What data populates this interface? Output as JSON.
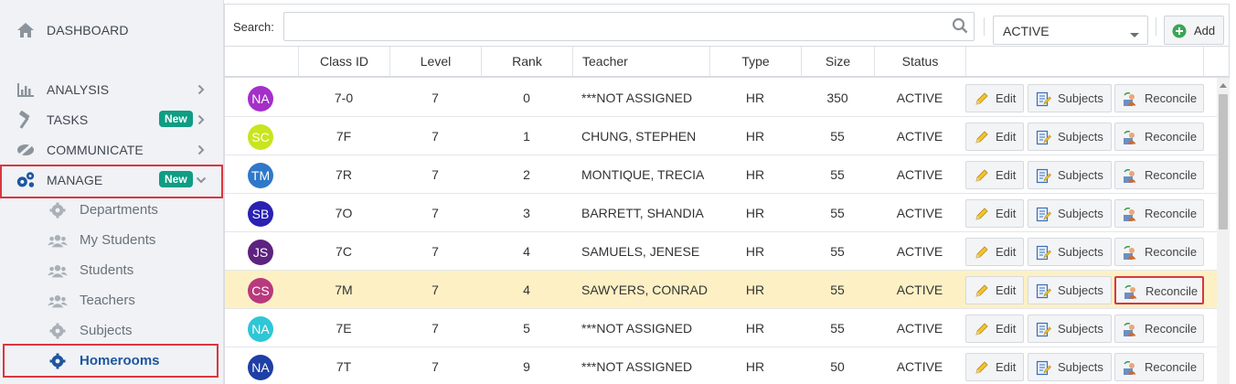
{
  "sidebar": {
    "nav": [
      {
        "label": "DASHBOARD",
        "icon": "home-icon"
      },
      {
        "label": "ANALYSIS",
        "icon": "bar-chart-icon"
      },
      {
        "label": "TASKS",
        "icon": "hammer-icon",
        "badge": "New"
      },
      {
        "label": "COMMUNICATE",
        "icon": "megaphone-icon"
      },
      {
        "label": "MANAGE",
        "icon": "gears-icon",
        "badge": "New"
      }
    ],
    "manage_items": [
      {
        "label": "Departments",
        "icon": "gear-icon"
      },
      {
        "label": "My Students",
        "icon": "users-icon"
      },
      {
        "label": "Students",
        "icon": "users-icon"
      },
      {
        "label": "Teachers",
        "icon": "users-icon"
      },
      {
        "label": "Subjects",
        "icon": "gear-icon"
      },
      {
        "label": "Homerooms",
        "icon": "gear-icon",
        "active": true
      }
    ]
  },
  "toolbar": {
    "search_label": "Search:",
    "search_value": "",
    "status_value": "ACTIVE",
    "add_label": "Add"
  },
  "table": {
    "columns": [
      "Class ID",
      "Level",
      "Rank",
      "Teacher",
      "Type",
      "Size",
      "Status"
    ],
    "actions": {
      "edit": "Edit",
      "subjects": "Subjects",
      "reconcile": "Reconcile"
    },
    "rows": [
      {
        "initials": "NA",
        "color": "#a52fc9",
        "class_id": "7-0",
        "level": "7",
        "rank": "0",
        "teacher": "***NOT ASSIGNED",
        "type": "HR",
        "size": "350",
        "status": "ACTIVE"
      },
      {
        "initials": "SC",
        "color": "#c8e51f",
        "class_id": "7F",
        "level": "7",
        "rank": "1",
        "teacher": "CHUNG, STEPHEN",
        "type": "HR",
        "size": "55",
        "status": "ACTIVE"
      },
      {
        "initials": "TM",
        "color": "#2f78c9",
        "class_id": "7R",
        "level": "7",
        "rank": "2",
        "teacher": "MONTIQUE, TRECIA",
        "type": "HR",
        "size": "55",
        "status": "ACTIVE"
      },
      {
        "initials": "SB",
        "color": "#2a21b3",
        "class_id": "7O",
        "level": "7",
        "rank": "3",
        "teacher": "BARRETT, SHANDIA",
        "type": "HR",
        "size": "55",
        "status": "ACTIVE"
      },
      {
        "initials": "JS",
        "color": "#5e2280",
        "class_id": "7C",
        "level": "7",
        "rank": "4",
        "teacher": "SAMUELS, JENESE",
        "type": "HR",
        "size": "55",
        "status": "ACTIVE"
      },
      {
        "initials": "CS",
        "color": "#b8397d",
        "class_id": "7M",
        "level": "7",
        "rank": "4",
        "teacher": "SAWYERS, CONRAD",
        "type": "HR",
        "size": "55",
        "status": "ACTIVE",
        "selected": true
      },
      {
        "initials": "NA",
        "color": "#2fc6d6",
        "class_id": "7E",
        "level": "7",
        "rank": "5",
        "teacher": "***NOT ASSIGNED",
        "type": "HR",
        "size": "55",
        "status": "ACTIVE"
      },
      {
        "initials": "NA",
        "color": "#1e3fa6",
        "class_id": "7T",
        "level": "7",
        "rank": "9",
        "teacher": "***NOT ASSIGNED",
        "type": "HR",
        "size": "50",
        "status": "ACTIVE"
      }
    ]
  }
}
